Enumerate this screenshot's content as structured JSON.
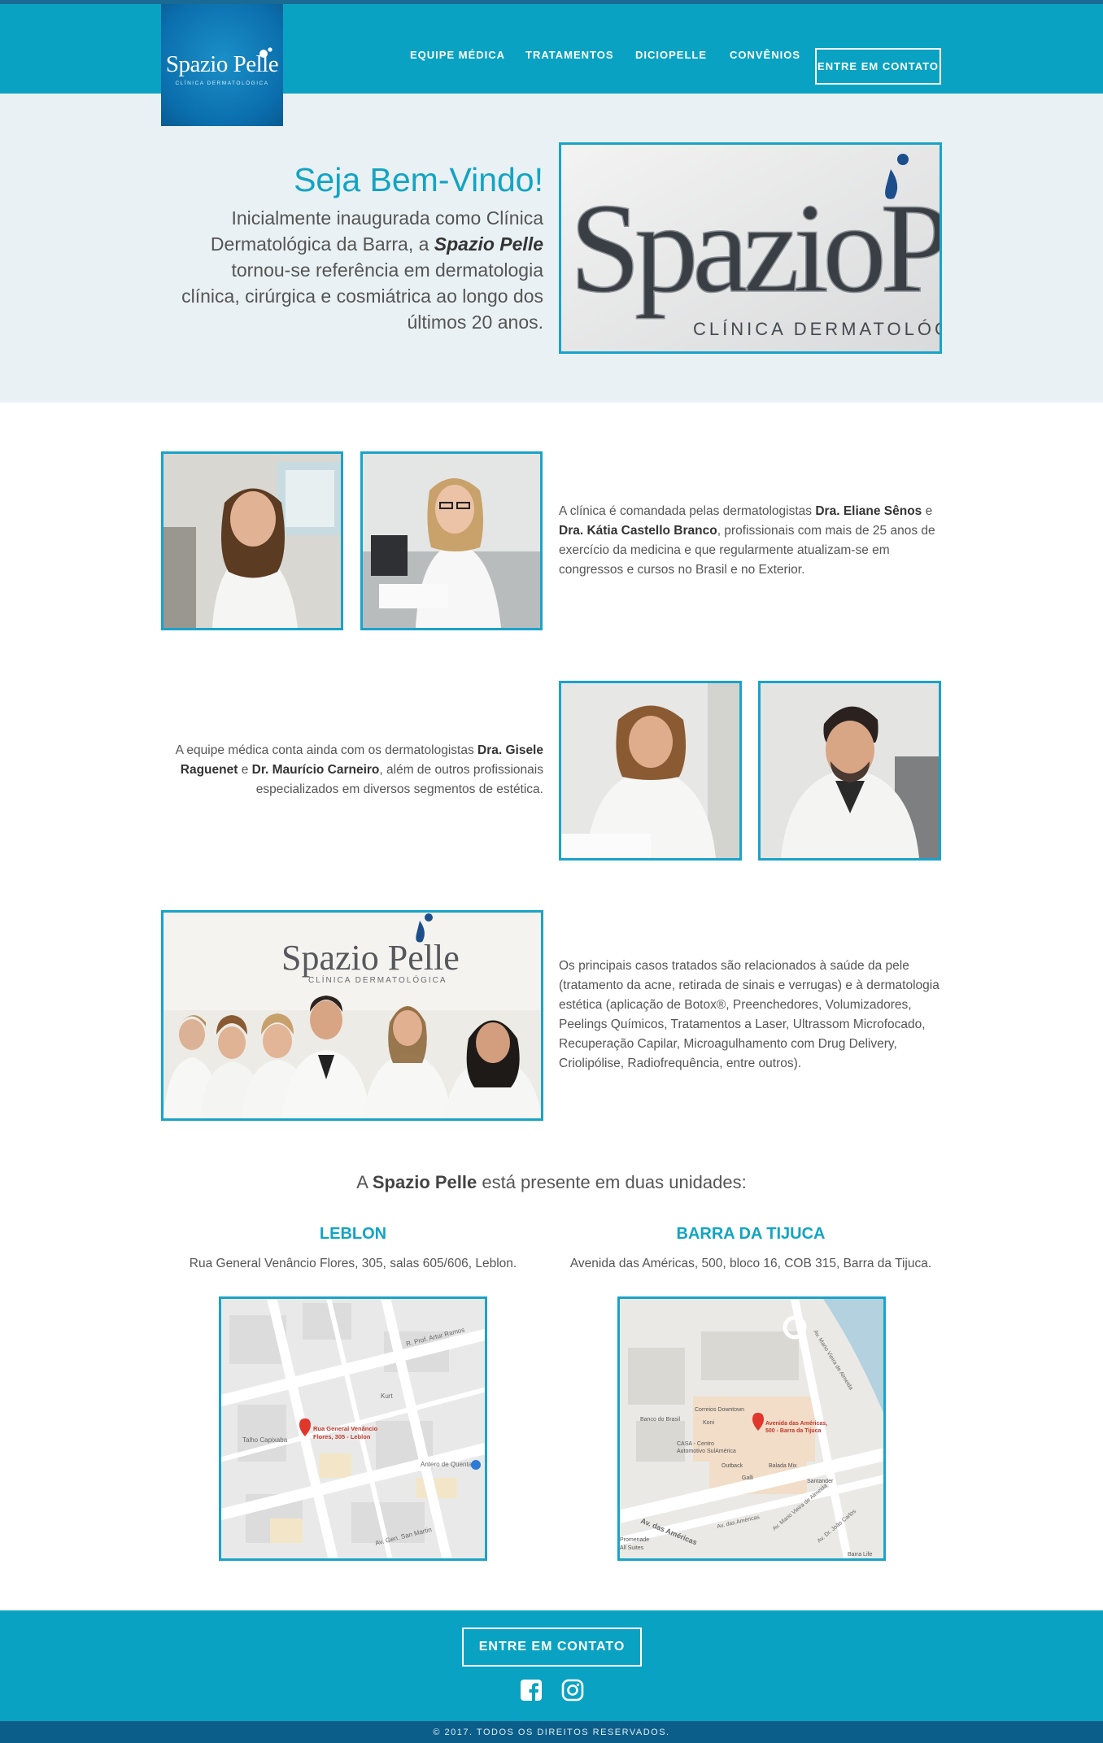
{
  "header": {
    "logo_text": "Spazio Pelle",
    "logo_subtext": "CLÍNICA DERMATOLÓGICA",
    "nav": [
      "EQUIPE MÉDICA",
      "TRATAMENTOS",
      "DICIOPELLE",
      "CONVÊNIOS"
    ],
    "cta": "ENTRE EM CONTATO"
  },
  "hero": {
    "title": "Seja Bem-Vindo!",
    "text_before": "Inicialmente inaugurada como Clínica Dermatológica da Barra, a ",
    "brand": "Spazio Pelle",
    "text_after": " tornou-se referência em dermatologia clínica, cirúrgica e cosmiátrica ao longo dos últimos 20 anos.",
    "sign_word": "SpazioPelle",
    "sign_sub": "CLÍNICA DERMATOLÓGICA"
  },
  "section1": {
    "t1": "A clínica é comandada pelas dermatologistas ",
    "b1": "Dra. Eliane Sênos",
    "t2": " e ",
    "b2": "Dra. Kátia Castello Branco",
    "t3": ", profissionais com mais de 25 anos de exercício da medicina e que regularmente atualizam-se em congressos e cursos no Brasil e no Exterior."
  },
  "section2": {
    "t1": "A equipe médica conta ainda com os dermatologistas ",
    "b1": "Dra. Gisele Raguenet",
    "t2": " e ",
    "b2": "Dr. Maurício Carneiro",
    "t3": ", além de outros profissionais especializados em diversos segmentos de estética."
  },
  "section3": {
    "text": "Os principais casos tratados são relacionados à saúde da pele (tratamento da acne, retirada de sinais e verrugas) e à dermatologia estética (aplicação de Botox®, Preenchedores, Volumizadores, Peelings Químicos, Tratamentos a Laser, Ultrassom Microfocado, Recuperação Capilar, Microagulhamento com Drug Delivery, Criolipólise, Radiofrequência, entre outros).",
    "wall_logo": "Spazio Pelle",
    "wall_sub": "CLÍNICA DERMATOLÓGICA"
  },
  "units": {
    "prefix": "A ",
    "brand": "Spazio Pelle",
    "suffix": " está presente em duas unidades:",
    "leblon": {
      "name": "LEBLON",
      "address": "Rua General Venâncio Flores, 305, salas 605/606, Leblon.",
      "map_pin_1": "Rua General Venâncio",
      "map_pin_2": "Flores, 305 - Leblon",
      "map_labels": [
        "R. Prof. Artur Ramos",
        "Kurt",
        "Talho Capixaba",
        "Antero de Quental",
        "Av. Gen. San Martin"
      ]
    },
    "barra": {
      "name": "BARRA DA TIJUCA",
      "address": "Avenida das Américas, 500, bloco 16, COB 315, Barra da Tijuca.",
      "map_pin_1": "Avenida das Américas,",
      "map_pin_2": "500 - Barra da Tijuca",
      "map_labels": [
        "Av. Mario Vieira de Almeida",
        "Correios Downtown",
        "Banco do Brasil",
        "Koni",
        "CASA - Centro",
        "Automotivo SulAmérica",
        "Outback",
        "Balada Mix",
        "Galli",
        "Santander",
        "Av. das Américas",
        "Av. das Américas",
        "Av. Mario Vieira de Almeida",
        "Av. Dr. João Carlos",
        "Barra Life",
        "Promenade",
        "All Suites"
      ]
    }
  },
  "footer": {
    "cta": "ENTRE EM CONTATO",
    "copyright": "© 2017. TODOS OS DIREITOS RESERVADOS."
  },
  "colors": {
    "accent": "#0aa2c2",
    "dark_blue": "#0c5e8a",
    "hero_bg": "#eaf1f4"
  }
}
